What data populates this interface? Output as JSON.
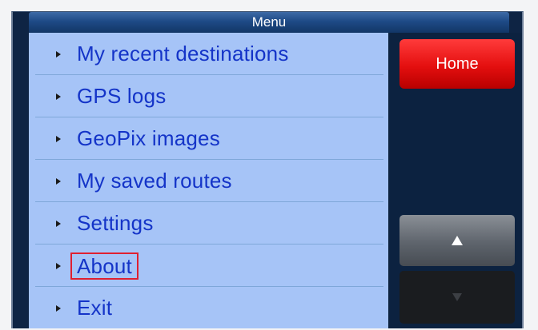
{
  "title": "Menu",
  "menu": {
    "items": [
      {
        "label": "My recent destinations",
        "highlighted": false
      },
      {
        "label": "GPS logs",
        "highlighted": false
      },
      {
        "label": "GeoPix images",
        "highlighted": false
      },
      {
        "label": "My saved routes",
        "highlighted": false
      },
      {
        "label": "Settings",
        "highlighted": false
      },
      {
        "label": "About",
        "highlighted": true
      },
      {
        "label": "Exit",
        "highlighted": false
      }
    ]
  },
  "side": {
    "home_label": "Home",
    "up_icon": "triangle-up",
    "down_icon": "triangle-down"
  },
  "colors": {
    "menu_background": "#a6c4f7",
    "menu_text": "#1434c8",
    "home_button": "#e40f0f",
    "highlight_border": "#e02030"
  }
}
